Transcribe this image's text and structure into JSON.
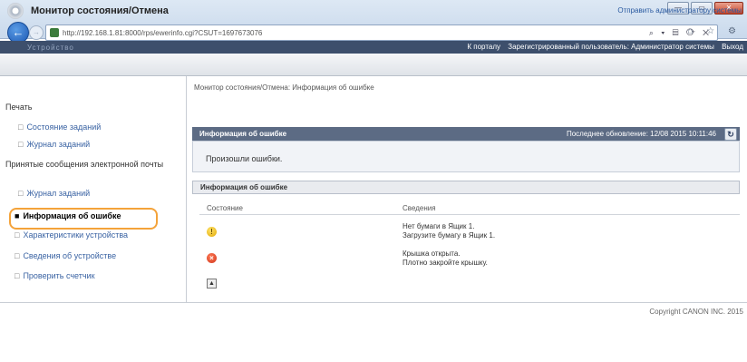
{
  "browser": {
    "url": "http://192.168.1.81:8000/rps/ewerinfo.cgi?CSUT=1697673076",
    "address_tools": "⌕ ▾ ▤ ⟳ ✕",
    "toolbar_icons": "⌂ ☆ ⚙",
    "window_buttons": {
      "min": "—",
      "max": "▭",
      "close": "✕"
    }
  },
  "navbar": {
    "left_text": "Устройство",
    "portal_link": "К порталу",
    "user_text": "Зарегистрированный пользователь: Администратор системы",
    "logout": "Выход"
  },
  "header": {
    "title": "Монитор состояния/Отмена",
    "send_admin": "Отправить администратору системы"
  },
  "sidebar": {
    "section_print": "Печать",
    "job_status": "Состояние заданий",
    "job_log": "Журнал заданий",
    "section_email": "Принятые сообщения электронной почты",
    "email_log": "Журнал заданий",
    "error_info": "Информация об ошибке",
    "device_features": "Характеристики устройства",
    "device_info": "Сведения об устройстве",
    "check_counter": "Проверить счетчик"
  },
  "main": {
    "breadcrumb": "Монитор состояния/Отмена: Информация об ошибке",
    "panel_title": "Информация об ошибке",
    "last_update": "Последнее обновление: 12/08 2015 10:11:46",
    "status_text": "Произошли ошибки.",
    "info_title": "Информация об ошибке",
    "col_state": "Состояние",
    "col_info": "Сведения",
    "rows": [
      {
        "line1": "Нет бумаги в Ящик 1.",
        "line2": "Загрузите бумагу в Ящик 1."
      },
      {
        "line1": "Крышка открыта.",
        "line2": "Плотно закройте крышку."
      }
    ]
  },
  "footer": {
    "copyright": "Copyright CANON INC. 2015"
  },
  "colors": {
    "navbar": "#3d4f6c",
    "panel_header": "#5c6b84",
    "highlight": "#f4a33a",
    "link": "#3a63a3"
  }
}
